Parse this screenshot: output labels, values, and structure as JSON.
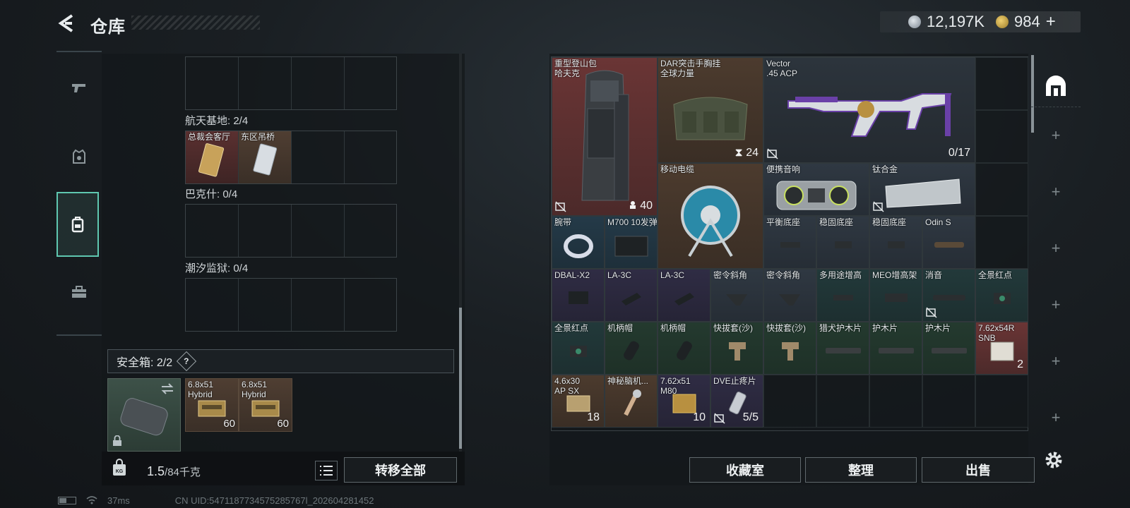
{
  "header": {
    "title": "仓库",
    "currency": {
      "silver": "12,197K",
      "gold": "984",
      "plus": "+"
    }
  },
  "nav": [
    "weapons",
    "armor",
    "backpack",
    "toolbox"
  ],
  "storage": {
    "sections": [
      {
        "label": "航天基地: 2/4",
        "items": [
          "总裁会客厅",
          "东区吊桥"
        ]
      },
      {
        "label": "巴克什: 0/4"
      },
      {
        "label": "潮汐监狱: 0/4"
      }
    ],
    "safe_box": {
      "label": "安全箱: 2/2",
      "help": "?",
      "items": [
        {
          "name": "6.8x51\nHybrid",
          "count": "60"
        },
        {
          "name": "6.8x51\nHybrid",
          "count": "60"
        }
      ]
    },
    "weight": {
      "current": "1.5",
      "max": "/84千克"
    },
    "transfer_all": "转移全部"
  },
  "inventory": {
    "items": {
      "backpack": {
        "name": "重型登山包\n哈夫克",
        "count": "40"
      },
      "chest_rig": {
        "name": "DAR突击手胸挂\n全球力量",
        "count": "24"
      },
      "vector": {
        "name": "Vector\n.45 ACP",
        "count": "0/17"
      },
      "cable": {
        "name": "移动电缆"
      },
      "boombox": {
        "name": "便携音响"
      },
      "titanium": {
        "name": "钛合金"
      },
      "wristband": {
        "name": "腕带"
      },
      "m700": {
        "name": "M700 10发弹匣"
      },
      "balance_mount": {
        "name": "平衡底座"
      },
      "stable_mount_1": {
        "name": "稳固底座"
      },
      "stable_mount_2": {
        "name": "稳固底座"
      },
      "odin": {
        "name": "Odin S"
      },
      "dbal": {
        "name": "DBAL-X2"
      },
      "la3c_1": {
        "name": "LA-3C"
      },
      "la3c_2": {
        "name": "LA-3C"
      },
      "angled_grip_1": {
        "name": "密令斜角"
      },
      "angled_grip_2": {
        "name": "密令斜角"
      },
      "riser": {
        "name": "多用途增高"
      },
      "meo_riser": {
        "name": "MEO增高架"
      },
      "suppressor": {
        "name": "消音"
      },
      "panoramic_1": {
        "name": "全景红点"
      },
      "panoramic_2": {
        "name": "全景红点"
      },
      "grip_cap_1": {
        "name": "机柄帽"
      },
      "grip_cap_2": {
        "name": "机柄帽"
      },
      "quick_sleeve_1": {
        "name": "快拔套(沙)"
      },
      "quick_sleeve_2": {
        "name": "快拔套(沙)"
      },
      "handguard_hound": {
        "name": "猎犬护木片"
      },
      "handguard_1": {
        "name": "护木片"
      },
      "handguard_2": {
        "name": "护木片"
      },
      "ammo_762_snb": {
        "name": "7.62x54R\nSNB",
        "count": "2"
      },
      "ammo_46": {
        "name": "4.6x30\nAP SX",
        "count": "18"
      },
      "mystery_brain": {
        "name": "神秘脑机..."
      },
      "ammo_762_m80": {
        "name": "7.62x51\nM80",
        "count": "10"
      },
      "dve_painkiller": {
        "name": "DVE止疼片",
        "count": "5/5"
      }
    },
    "buttons": {
      "collection": "收藏室",
      "sort": "整理",
      "sell": "出售"
    },
    "side_tabs": [
      "+",
      "+",
      "+",
      "+",
      "+",
      "+",
      "+"
    ]
  },
  "status": {
    "ping": "37ms",
    "uid": "CN UID:5471187734575285767l_202604281452"
  },
  "colors": {
    "accent": "#5fc7b0",
    "rarity_red": "#6a3535",
    "rarity_brown": "#4c3b2e",
    "rarity_blue": "#243a48",
    "rarity_purple": "#2f2c44",
    "rarity_green": "#243a2f"
  }
}
